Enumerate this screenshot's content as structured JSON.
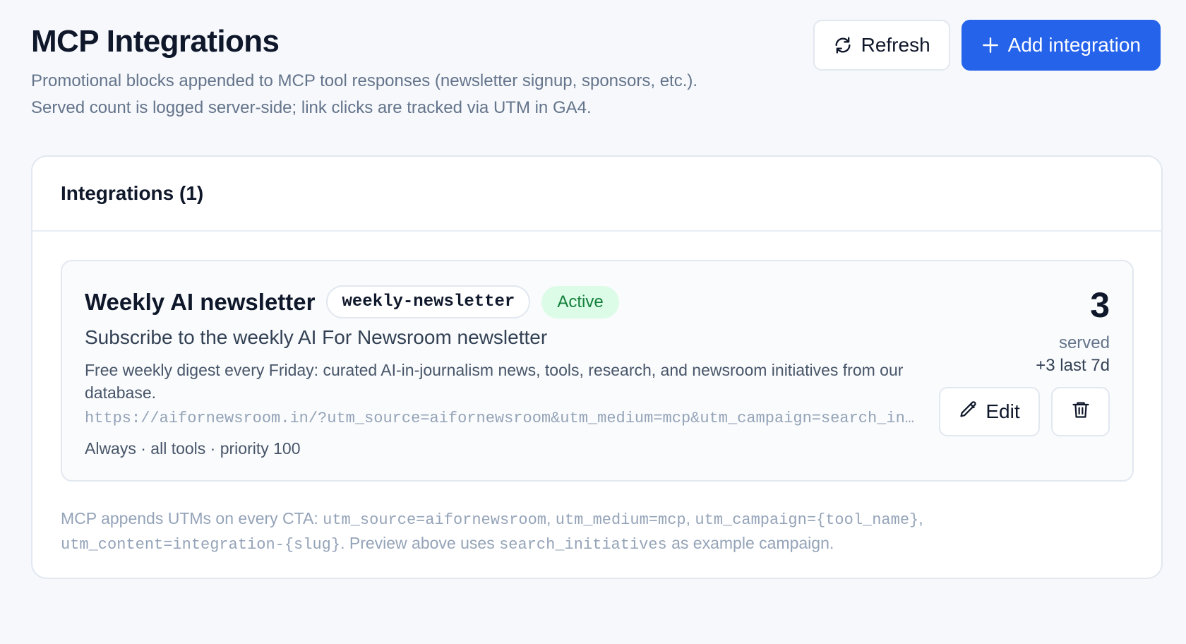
{
  "header": {
    "title": "MCP Integrations",
    "subtitle_line1": "Promotional blocks appended to MCP tool responses (newsletter signup, sponsors, etc.).",
    "subtitle_line2": "Served count is logged server-side; link clicks are tracked via UTM in GA4.",
    "refresh_label": "Refresh",
    "add_label": "Add integration"
  },
  "list": {
    "title": "Integrations (1)",
    "items": [
      {
        "name": "Weekly AI newsletter",
        "slug": "weekly-newsletter",
        "status": "Active",
        "headline": "Subscribe to the weekly AI For Newsroom newsletter",
        "description": "Free weekly digest every Friday: curated AI-in-journalism news, tools, research, and newsroom initiatives from our database.",
        "url": "https://aifornewsroom.in/?utm_source=aifornewsroom&utm_medium=mcp&utm_campaign=search_initiatives&utm_content=integration-weekly-newsletter",
        "meta": "Always · all tools · priority 100",
        "served_count": "3",
        "served_label": "served",
        "served_delta": "+3 last 7d",
        "edit_label": "Edit"
      }
    ]
  },
  "footnote": {
    "prefix": "MCP appends UTMs on every CTA: ",
    "utm_source": "utm_source=aifornewsroom",
    "sep1": ", ",
    "utm_medium": "utm_medium=mcp",
    "sep2": ", ",
    "utm_campaign": "utm_campaign={tool_name}",
    "sep3": ", ",
    "utm_content": "utm_content=integration-{slug}",
    "middle": ". Preview above uses ",
    "example_campaign": "search_initiatives",
    "suffix": " as example campaign."
  },
  "colors": {
    "primary": "#2563eb",
    "active_bg": "#dcfce7",
    "active_text": "#15803d",
    "page_bg": "#f6f8fb"
  },
  "icons": {
    "refresh": "refresh-icon",
    "add": "plus-icon",
    "edit": "pencil-icon",
    "delete": "trash-icon"
  }
}
